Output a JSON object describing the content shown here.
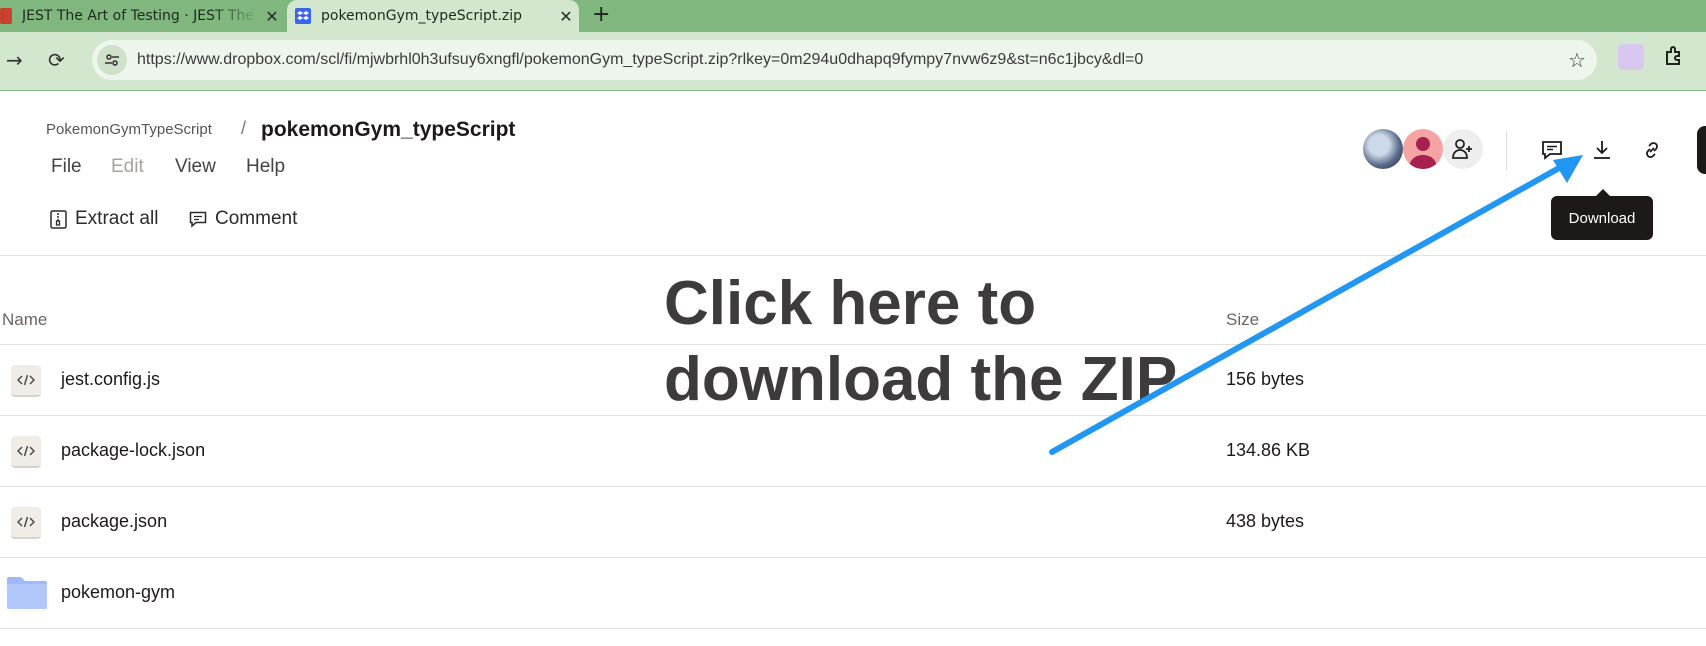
{
  "browser": {
    "tabs": [
      {
        "title": "JEST The Art of Testing · JEST The Art of Testing",
        "close": "✕"
      },
      {
        "title": "pokemonGym_typeScript.zip",
        "close": "✕"
      }
    ],
    "new_tab": "+",
    "url": "https://www.dropbox.com/scl/fi/mjwbrhl0h3ufsuy6xngfl/pokemonGym_typeScript.zip?rlkey=0m294u0dhapq9fympy7nvw6z9&st=n6c1jbcy&dl=0"
  },
  "page": {
    "breadcrumb": {
      "parent": "PokemonGymTypeScript",
      "separator": "/",
      "current": "pokemonGym_typeScript"
    },
    "menu": [
      "File",
      "Edit",
      "View",
      "Help"
    ],
    "actions": {
      "extract_all": "Extract all",
      "comment": "Comment"
    },
    "tooltip": "Download",
    "columns": {
      "name": "Name",
      "size": "Size"
    },
    "files": [
      {
        "name": "jest.config.js",
        "size": "156 bytes",
        "icon": "code-file-icon"
      },
      {
        "name": "package-lock.json",
        "size": "134.86 KB",
        "icon": "code-file-icon"
      },
      {
        "name": "package.json",
        "size": "438 bytes",
        "icon": "code-file-icon"
      },
      {
        "name": "pokemon-gym",
        "size": "",
        "icon": "folder-icon"
      }
    ]
  },
  "annotation": {
    "line1": "Click here to",
    "line2": "download the ZIP",
    "arrow_color": "#2196f3"
  },
  "colors": {
    "tab_bar": "#7fb77e",
    "toolbar": "#d3e7cf",
    "folder": "#9fb8f7"
  }
}
